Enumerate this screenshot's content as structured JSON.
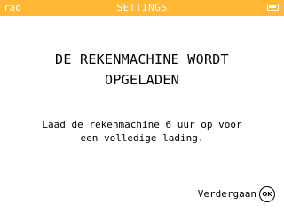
{
  "statusbar": {
    "angle_mode": "rad",
    "title": "SETTINGS",
    "battery_icon": "battery-full-icon",
    "background_color": "#FFB734"
  },
  "main": {
    "heading_lines": [
      "DE REKENMACHINE WORDT",
      "OPGELADEN"
    ],
    "message_lines": [
      "Laad de rekenmachine 6 uur op voor",
      "een volledige lading."
    ]
  },
  "footer": {
    "continue_label": "Verdergaan",
    "ok_key_label": "OK",
    "ok_key_icon": "ok-key-icon"
  }
}
